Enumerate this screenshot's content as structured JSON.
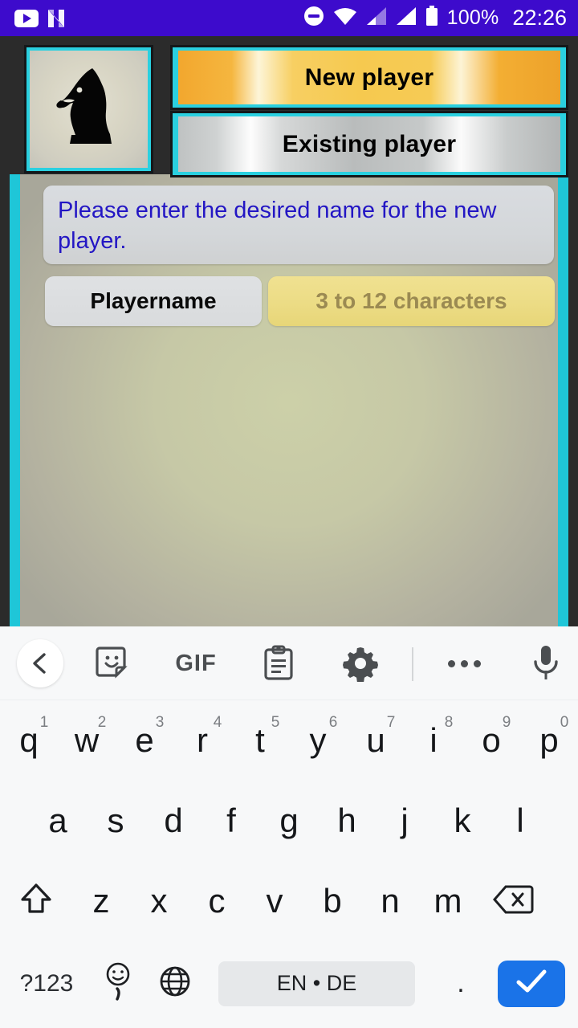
{
  "status_bar": {
    "background": "#3d0bcc",
    "icons": [
      "youtube-icon",
      "nova-launcher-icon",
      "do-not-disturb-icon",
      "wifi-icon",
      "signal-icon-1",
      "signal-icon-2",
      "battery-icon"
    ],
    "battery_percent": "100%",
    "clock": "22:26"
  },
  "app": {
    "accent_border": "#1fc6d8",
    "avatar_icon": "chess-knight-icon",
    "buttons": [
      {
        "id": "new-player",
        "label": "New player",
        "style": "gold"
      },
      {
        "id": "existing-player",
        "label": "Existing player",
        "style": "silver"
      }
    ],
    "message": "Please enter the desired name for the new player.",
    "message_color": "#2316c4",
    "form": {
      "label": "Playername",
      "input_value": "",
      "input_placeholder": "3 to 12 characters",
      "input_background": "#ecdc85"
    }
  },
  "keyboard": {
    "toolbar": {
      "back": "back-chevron-icon",
      "sticker": "sticker-icon",
      "gif_label": "GIF",
      "clipboard": "clipboard-icon",
      "settings": "gear-icon",
      "more": "more-dots-icon",
      "mic": "microphone-icon"
    },
    "row1": [
      {
        "key": "q",
        "sup": "1"
      },
      {
        "key": "w",
        "sup": "2"
      },
      {
        "key": "e",
        "sup": "3"
      },
      {
        "key": "r",
        "sup": "4"
      },
      {
        "key": "t",
        "sup": "5"
      },
      {
        "key": "y",
        "sup": "6"
      },
      {
        "key": "u",
        "sup": "7"
      },
      {
        "key": "i",
        "sup": "8"
      },
      {
        "key": "o",
        "sup": "9"
      },
      {
        "key": "p",
        "sup": "0"
      }
    ],
    "row2": [
      {
        "key": "a"
      },
      {
        "key": "s"
      },
      {
        "key": "d"
      },
      {
        "key": "f"
      },
      {
        "key": "g"
      },
      {
        "key": "h"
      },
      {
        "key": "j"
      },
      {
        "key": "k"
      },
      {
        "key": "l"
      }
    ],
    "row3": [
      {
        "key": "z"
      },
      {
        "key": "x"
      },
      {
        "key": "c"
      },
      {
        "key": "v"
      },
      {
        "key": "b"
      },
      {
        "key": "n"
      },
      {
        "key": "m"
      }
    ],
    "shift": "shift-icon",
    "backspace": "backspace-icon",
    "row4": {
      "symbols_label": "?123",
      "emoji": "emoji-comma-icon",
      "globe": "globe-icon",
      "space_label": "EN • DE",
      "period_label": ".",
      "enter": "checkmark-icon",
      "enter_color": "#1a73e8"
    }
  }
}
